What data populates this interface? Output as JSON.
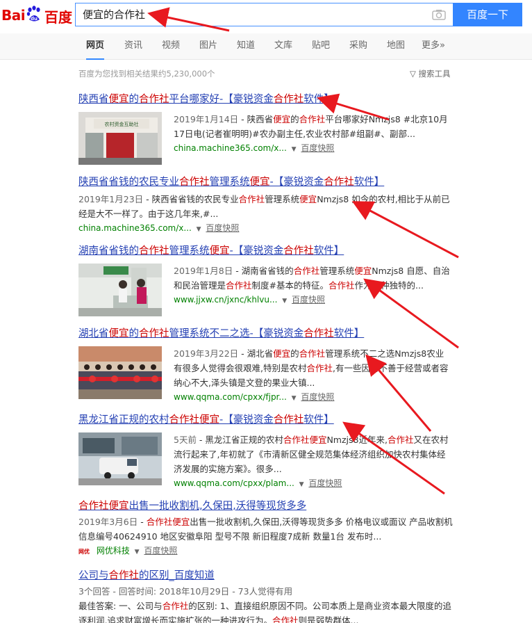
{
  "header": {
    "logo_text_bai": "Bai",
    "logo_text_cn": "百度",
    "query": "便宜的合作社",
    "search_button": "百度一下"
  },
  "tabs": [
    "网页",
    "资讯",
    "视频",
    "图片",
    "知道",
    "文库",
    "贴吧",
    "采购",
    "地图",
    "更多»"
  ],
  "result_count": "百度为您找到相关结果约5,230,000个",
  "search_tools": "搜索工具",
  "results": [
    {
      "title": "陕西省便宜的合作社平台哪家好-【豪锐资金合作社软件】",
      "date": "2019年1月14日",
      "snippet": " - 陕西省便宜的合作社平台哪家好Nmzjs8 #北京10月17日电(记者崔明明)#农办副主任,农业农村部#组副#、副部...",
      "url": "china.machine365.com/x...",
      "kuaizhao": "百度快照"
    },
    {
      "title": "陕西省省钱的农民专业合作社管理系统便宜-【豪锐资金合作社软件】",
      "date": "2019年1月23日",
      "snippet": " - 陕西省省钱的农民专业合作社管理系统便宜Nmzjs8 如今的农村,相比于从前已经是大不一样了。由于这几年来,#...",
      "url": "china.machine365.com/x...",
      "kuaizhao": "百度快照"
    },
    {
      "title": "湖南省省钱的合作社管理系统便宜-【豪锐资金合作社软件】",
      "date": "2019年1月8日",
      "snippet": " - 湖南省省钱的合作社管理系统便宜Nmzjs8 自愿、自治和民治管理是合作社制度#基本的特征。合作社作为一种独特的...",
      "url": "www.jjxw.cn/jxnc/khlvu...",
      "kuaizhao": "百度快照"
    },
    {
      "title": "湖北省便宜的合作社管理系统不二之选-【豪锐资金合作社软件】",
      "date": "2019年3月22日",
      "snippet": " - 湖北省便宜的合作社管理系统不二之选Nmzjs8农业有很多人觉得会很艰难,特别是农村合作社,有一些因为不善于经营或者容纳心不大,泽头镇是文登的果业大镇...",
      "url": "www.qqma.com/cpxx/fjpr...",
      "kuaizhao": "百度快照"
    },
    {
      "title": "黑龙江省正规的农村合作社便宜-【豪锐资金合作社软件】",
      "date": "5天前",
      "snippet": " - 黑龙江省正规的农村合作社便宜Nmzjs8近年来,合作社又在农村流行起来了,年初就了《市清新区健全规范集体经济组织加快农村集体经济发展的实施方案》。很多...",
      "url": "www.qqma.com/cpxx/plam...",
      "kuaizhao": "百度快照"
    },
    {
      "title": "合作社便宜出售一批收割机,久保田,沃得等现货多多",
      "date": "2019年3月6日",
      "snippet": " - 合作社便宜出售一批收割机,久保田,沃得等现货多多 价格电议或面议 产品收割机 信息编号40624910 地区安徽阜阳 型号不限 新旧程度7成新 数量1台 发布时...",
      "source_logo": "网优",
      "url": "网优科技",
      "kuaizhao": "百度快照"
    },
    {
      "title": "公司与合作社的区别_百度知道",
      "meta": "3个回答 - 回答时间: 2018年10月29日 - 73人觉得有用",
      "snippet": "最佳答案: 一、公司与合作社的区别: 1、直接组织原因不同。公司本质上是商业资本最大限度的追逐利润,追求财富增长而实施扩张的一种进攻行为。合作社则是弱势群体..."
    }
  ],
  "colors": {
    "link": "#2440b3",
    "highlight": "#c00",
    "url": "#008000",
    "brand_blue": "#3385ff",
    "arrow": "#e8191f"
  }
}
